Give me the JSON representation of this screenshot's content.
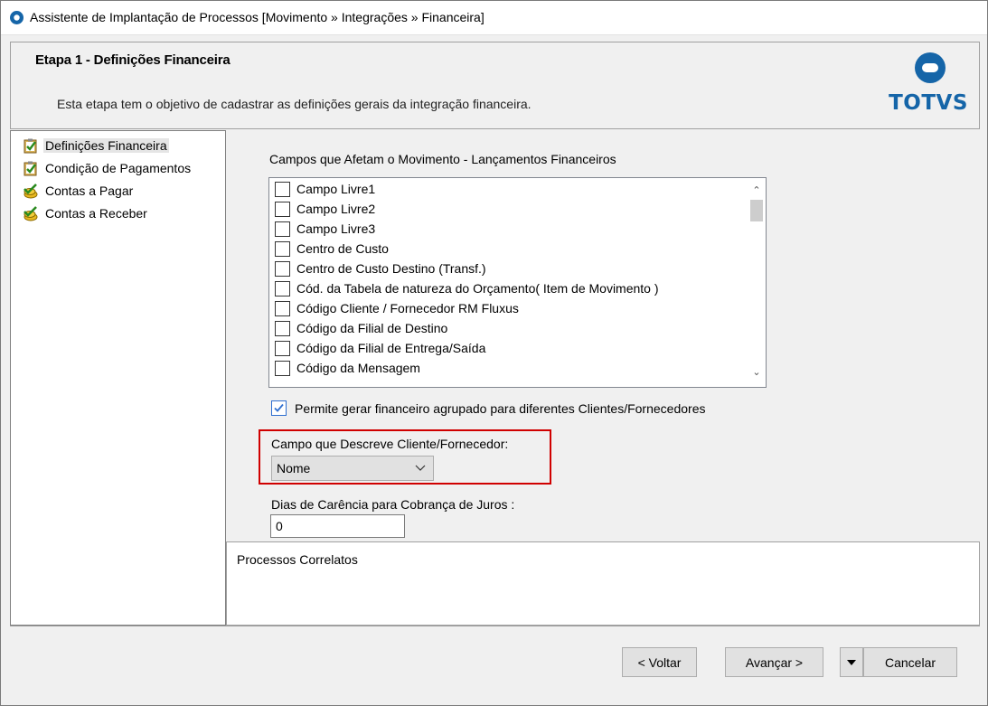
{
  "window": {
    "title": "Assistente de Implantação de Processos [Movimento » Integrações » Financeira]"
  },
  "header": {
    "step_title": "Etapa 1 - Definições Financeira",
    "description": "Esta etapa tem o objetivo de cadastrar as definições gerais da integração financeira.",
    "logo_text": "TOTVS"
  },
  "sidebar": {
    "items": [
      {
        "label": "Definições Financeira",
        "icon": "clipboard-check-icon"
      },
      {
        "label": "Condição de Pagamentos",
        "icon": "clipboard-check-icon"
      },
      {
        "label": "Contas a Pagar",
        "icon": "coins-check-icon"
      },
      {
        "label": "Contas a Receber",
        "icon": "coins-check-icon"
      }
    ]
  },
  "fields": {
    "group_label": "Campos que Afetam o Movimento - Lançamentos Financeiros",
    "list": [
      "Campo Livre1",
      "Campo Livre2",
      "Campo Livre3",
      "Centro de Custo",
      "Centro de Custo Destino (Transf.)",
      "Cód. da Tabela de natureza do Orçamento( Item de Movimento )",
      "Código Cliente / Fornecedor RM Fluxus",
      "Código da Filial de Destino",
      "Código da Filial de Entrega/Saída",
      "Código da Mensagem"
    ],
    "group_checkbox_label": "Permite gerar financeiro agrupado para diferentes Clientes/Fornecedores",
    "group_checkbox_checked": true,
    "describe_label": "Campo que Descreve Cliente/Fornecedor:",
    "describe_value": "Nome",
    "grace_label": "Dias de Carência para Cobrança de Juros :",
    "grace_value": "0"
  },
  "related": {
    "title": "Processos Correlatos"
  },
  "buttons": {
    "back": "< Voltar",
    "next": "Avançar >",
    "cancel": "Cancelar"
  },
  "colors": {
    "highlight_border": "#d00000",
    "logo_blue": "#1565a8",
    "checkbox_blue": "#2f6fd0"
  }
}
